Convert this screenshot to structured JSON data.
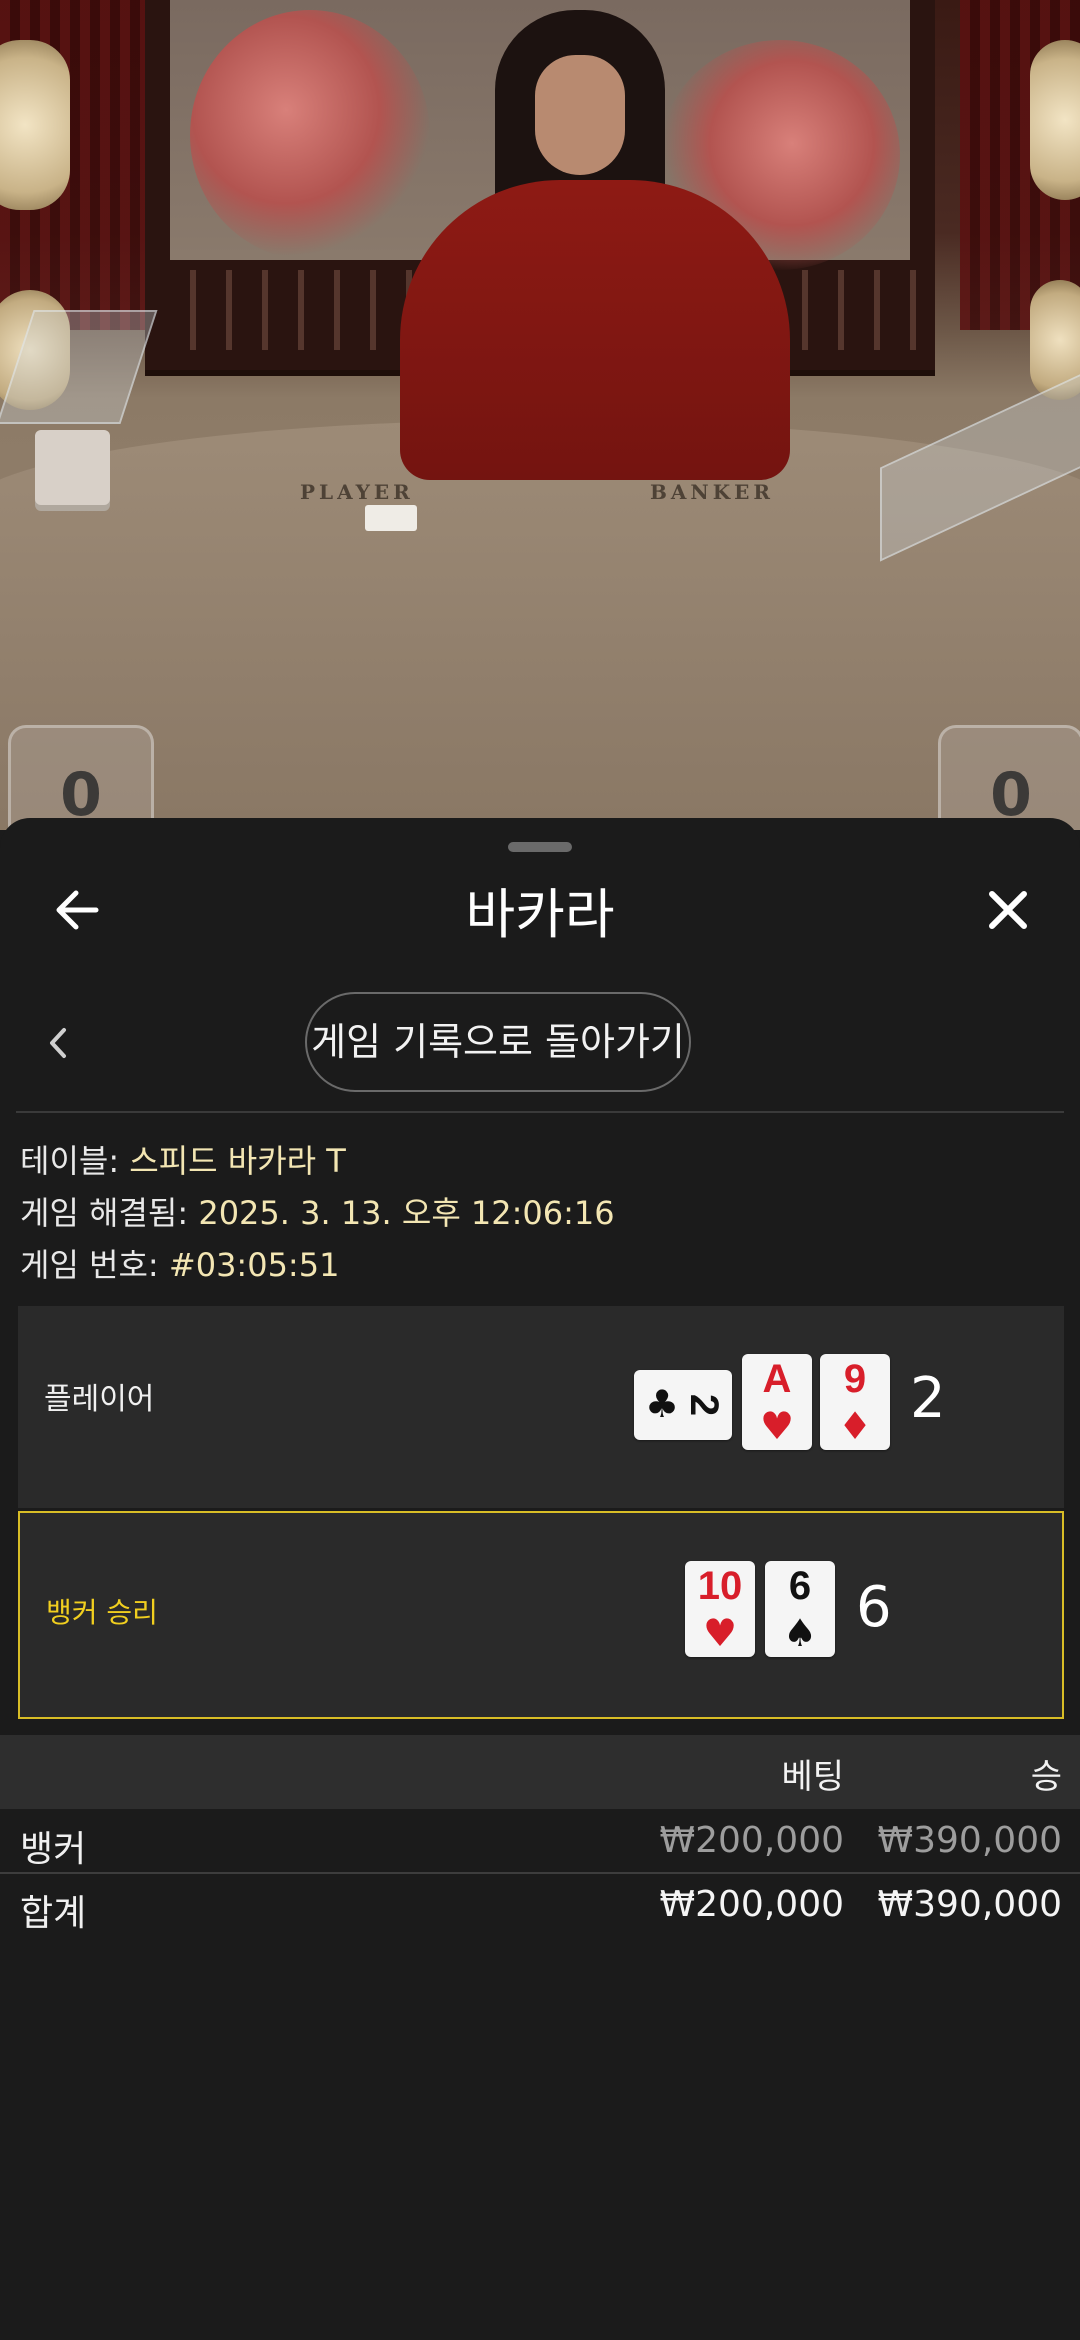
{
  "video": {
    "table_labels": [
      "PLAYER",
      "BANKER"
    ],
    "player_score_badge": "0",
    "banker_score_badge": "0"
  },
  "header": {
    "title": "바카라",
    "back_icon": "arrow-left-icon",
    "close_icon": "close-icon"
  },
  "nav": {
    "back_icon": "chevron-left-icon",
    "history_button_label": "게임 기록으로 돌아가기"
  },
  "game_info": {
    "table_label": "테이블: ",
    "table_value": "스피드 바카라 T",
    "resolved_label": "게임 해결됨: ",
    "resolved_value": "2025. 3. 13. 오후 12:06:16",
    "number_label": "게임 번호: ",
    "number_value": "#03:05:51"
  },
  "hands": {
    "player": {
      "label": "플레이어",
      "cards": [
        {
          "rank": "2",
          "suit": "♣",
          "color": "black",
          "orientation": "horizontal"
        },
        {
          "rank": "A",
          "suit": "♥",
          "color": "red"
        },
        {
          "rank": "9",
          "suit": "♦",
          "color": "red"
        }
      ],
      "score": "2"
    },
    "banker": {
      "label": "뱅커 승리",
      "cards": [
        {
          "rank": "10",
          "suit": "♥",
          "color": "red"
        },
        {
          "rank": "6",
          "suit": "♠",
          "color": "black"
        }
      ],
      "score": "6",
      "highlight_color": "#d8bd26"
    }
  },
  "bets_table": {
    "columns": [
      "베팅",
      "승"
    ],
    "rows": [
      {
        "name": "뱅커",
        "bet": "₩200,000",
        "win": "₩390,000"
      }
    ],
    "total": {
      "name": "합계",
      "bet": "₩200,000",
      "win": "₩390,000"
    }
  }
}
